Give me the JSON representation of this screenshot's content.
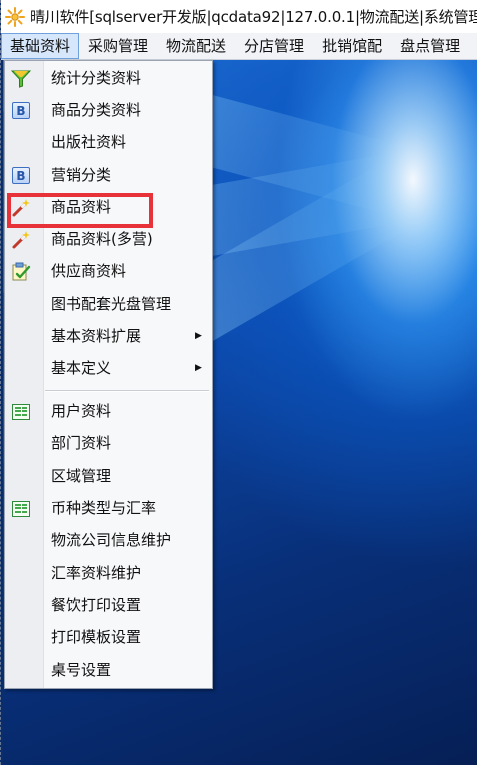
{
  "window": {
    "title": "晴川软件[sqlserver开发版|qcdata92|127.0.0.1|物流配送|系统管理",
    "app_icon": "sun-gear-icon"
  },
  "menubar": {
    "items": [
      {
        "label": "基础资料",
        "active": true
      },
      {
        "label": "采购管理",
        "active": false
      },
      {
        "label": "物流配送",
        "active": false
      },
      {
        "label": "分店管理",
        "active": false
      },
      {
        "label": "批销馆配",
        "active": false
      },
      {
        "label": "盘点管理",
        "active": false
      }
    ]
  },
  "dropdown": {
    "items": [
      {
        "label": "统计分类资料",
        "icon": "funnel-icon"
      },
      {
        "label": "商品分类资料",
        "icon": "b-letter-icon"
      },
      {
        "label": "出版社资料",
        "icon": ""
      },
      {
        "label": "营销分类",
        "icon": "b-letter-icon"
      },
      {
        "label": "商品资料",
        "icon": "magic-wand-icon",
        "highlighted": true
      },
      {
        "label": "商品资料(多营)",
        "icon": "magic-wand-icon"
      },
      {
        "label": "供应商资料",
        "icon": "checklist-icon"
      },
      {
        "label": "图书配套光盘管理",
        "icon": ""
      },
      {
        "label": "基本资料扩展",
        "icon": "",
        "submenu": true
      },
      {
        "label": "基本定义",
        "icon": "",
        "submenu": true
      },
      {
        "label": "用户资料",
        "icon": "table-grid-icon"
      },
      {
        "label": "部门资料",
        "icon": ""
      },
      {
        "label": "区域管理",
        "icon": ""
      },
      {
        "label": "币种类型与汇率",
        "icon": "table-grid-icon"
      },
      {
        "label": "物流公司信息维护",
        "icon": ""
      },
      {
        "label": "汇率资料维护",
        "icon": ""
      },
      {
        "label": "餐饮打印设置",
        "icon": ""
      },
      {
        "label": "打印模板设置",
        "icon": ""
      },
      {
        "label": "桌号设置",
        "icon": ""
      }
    ],
    "submenu_arrow": "▶",
    "b_icon_letter": "B"
  },
  "colors": {
    "highlight_border": "#e8323a",
    "desktop_blue": "#0d47a8",
    "menubar_active": "#d6e6fb"
  }
}
